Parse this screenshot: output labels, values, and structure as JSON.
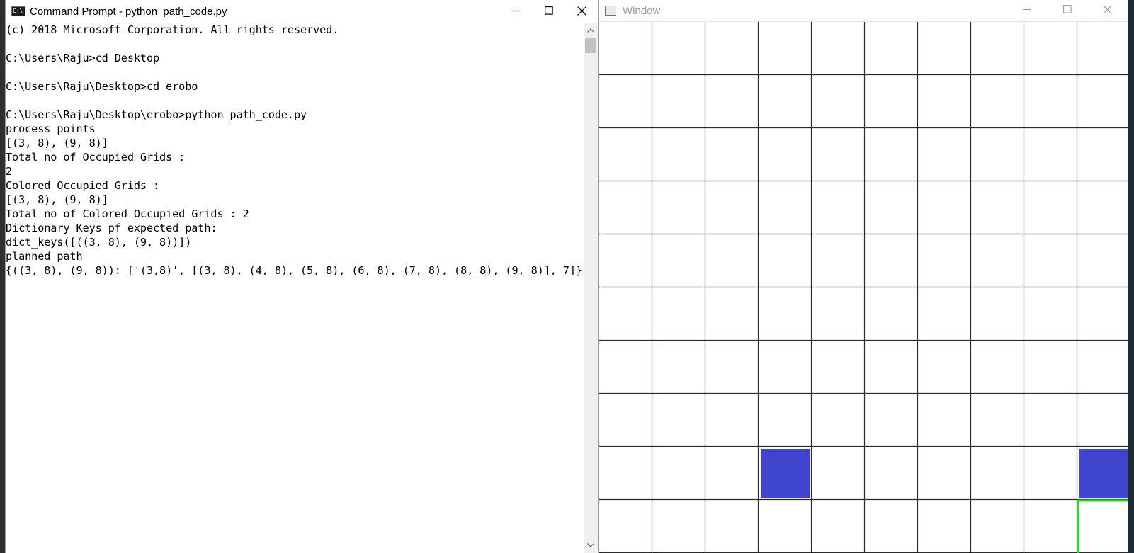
{
  "cmd": {
    "title": "Command Prompt - python  path_code.py",
    "lines": [
      "(c) 2018 Microsoft Corporation. All rights reserved.",
      "",
      "C:\\Users\\Raju>cd Desktop",
      "",
      "C:\\Users\\Raju\\Desktop>cd erobo",
      "",
      "C:\\Users\\Raju\\Desktop\\erobo>python path_code.py",
      "process points",
      "[(3, 8), (9, 8)]",
      "Total no of Occupied Grids :",
      "2",
      "Colored Occupied Grids :",
      "[(3, 8), (9, 8)]",
      "Total no of Colored Occupied Grids : 2",
      "Dictionary Keys pf expected_path:",
      "dict_keys([((3, 8), (9, 8))])",
      "planned path",
      "{((3, 8), (9, 8)): ['(3,8)', [(3, 8), (4, 8), (5, 8), (6, 8), (7, 8), (8, 8), (9, 8)], 7]}"
    ],
    "colors": {
      "background": "#ffffff",
      "text": "#000000"
    }
  },
  "grid_window": {
    "title": "Window",
    "rows": 10,
    "cols": 10,
    "occupied_cells": [
      {
        "col": 3,
        "row": 8,
        "color": "#3f45cf"
      },
      {
        "col": 9,
        "row": 8,
        "color": "#3f45cf"
      }
    ],
    "highlighted_cells": [
      {
        "col": 9,
        "row": 9,
        "color": "#22dd22"
      }
    ],
    "colors": {
      "background": "#ffffff",
      "grid_line": "#2a2a2a"
    }
  }
}
